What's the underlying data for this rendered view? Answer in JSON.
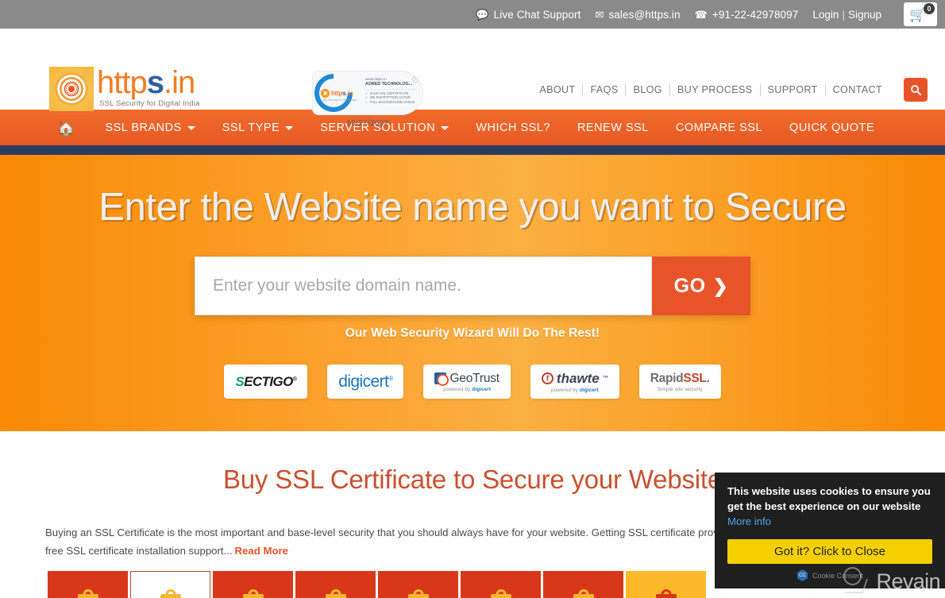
{
  "topbar": {
    "live_chat": "Live Chat Support",
    "live_chat_icon": "chat-bubble-icon",
    "email": "sales@https.in",
    "email_icon": "envelope-icon",
    "phone": "+91-22-42978097",
    "phone_icon": "headset-icon",
    "login": "Login",
    "separator": "|",
    "signup": "Signup",
    "cart_icon": "shopping-cart-icon",
    "cart_count": "0",
    "bg_color": "#8a8a8a"
  },
  "header": {
    "logo": {
      "word_a": "http",
      "word_b": "s",
      "word_c": ".in",
      "tagline": "SSL Security for Digital India",
      "mark_icon": "mandala-sun-icon",
      "color_orange": "#f47b20",
      "color_blue": "#2e5fa3"
    },
    "seal": {
      "brand_prefix": "http",
      "brand_mid": "s",
      "brand_suffix": ".in",
      "brand_sub": "SSL Security for Digital India",
      "url": "www.https.in",
      "company": "AORED TECHNOLOG...",
      "bullets": [
        "VALID SSL CERTIFICATE",
        "256 ENCRYPTION ACTIVE",
        "FULL BACKGROUND CHECK"
      ],
      "help_icon": "question-mark-icon",
      "date": "10/27/2022"
    },
    "nav": [
      "ABOUT",
      "FAQS",
      "BLOG",
      "BUY PROCESS",
      "SUPPORT",
      "CONTACT"
    ],
    "search_icon": "search-icon",
    "search_btn_color": "#e8542a"
  },
  "mainnav": {
    "home_icon": "home-icon",
    "items": [
      {
        "label": "SSL BRANDS",
        "has_caret": true
      },
      {
        "label": "SSL TYPE",
        "has_caret": true
      },
      {
        "label": "SERVER SOLUTION",
        "has_caret": true
      },
      {
        "label": "WHICH SSL?",
        "has_caret": false
      },
      {
        "label": "RENEW SSL",
        "has_caret": false
      },
      {
        "label": "COMPARE SSL",
        "has_caret": false
      },
      {
        "label": "QUICK QUOTE",
        "has_caret": false
      }
    ],
    "bg_color": "#e95a24",
    "rule_color": "#2b3c61"
  },
  "hero": {
    "title": "Enter the Website name you want to Secure",
    "input_placeholder": "Enter your website domain name.",
    "input_value": "",
    "go_label": "GO",
    "go_chevron": "❯",
    "subtitle": "Our Web Security Wizard Will Do The Rest!",
    "bg_color": "#f98a05",
    "brands": [
      {
        "name": "SECTIGO",
        "lead": "S",
        "rest": "ECTIGO",
        "mark": "®",
        "sub": ""
      },
      {
        "name": "digicert",
        "text": "digicert",
        "mark": "®",
        "sub": ""
      },
      {
        "name": "GeoTrust",
        "text": "GeoTrust",
        "sub_prefix": "powered by ",
        "sub_brand": "digicert",
        "icon": "geotrust-icon"
      },
      {
        "name": "thawte",
        "text": "thawte",
        "mark": "™",
        "sub_prefix": "powered by ",
        "sub_brand": "digicert",
        "icon": "thawte-circle-t-icon"
      },
      {
        "name": "RapidSSL",
        "text_a": "Rapid",
        "text_b": "SSL",
        "mark": ".",
        "sub": "Simple site security"
      }
    ]
  },
  "content": {
    "title": "Buy SSL Certificate to Secure your Website",
    "paragraph": "Buying an SSL Certificate is the most important and base-level security that you should always have for your website. Getting SSL certificate provider gives peace of mind as we provide free SSL certificate installation support...",
    "read_more": "Read More",
    "title_color": "#c9502e",
    "cards": [
      {
        "state": "default",
        "icon": "padlock-icon"
      },
      {
        "state": "selected",
        "icon": "padlock-icon"
      },
      {
        "state": "default",
        "icon": "padlock-icon"
      },
      {
        "state": "default",
        "icon": "padlock-icon"
      },
      {
        "state": "default",
        "icon": "padlock-icon"
      },
      {
        "state": "default",
        "icon": "padlock-icon"
      },
      {
        "state": "default",
        "icon": "padlock-icon"
      },
      {
        "state": "alt",
        "icon": "padlock-icon"
      }
    ]
  },
  "cookie": {
    "message_part1": "This website uses cookies to ensure you get the best experience on our website",
    "more_info": "More info",
    "button_label": "Got it? Click to Close",
    "credit": "Cookie Consent",
    "credit_icon": "cookie-consent-badge-icon",
    "button_color": "#f5d000",
    "bg_color": "#1f1f1f"
  },
  "watermark": {
    "text": "Revain",
    "icon": "magnifier-logo-icon"
  }
}
